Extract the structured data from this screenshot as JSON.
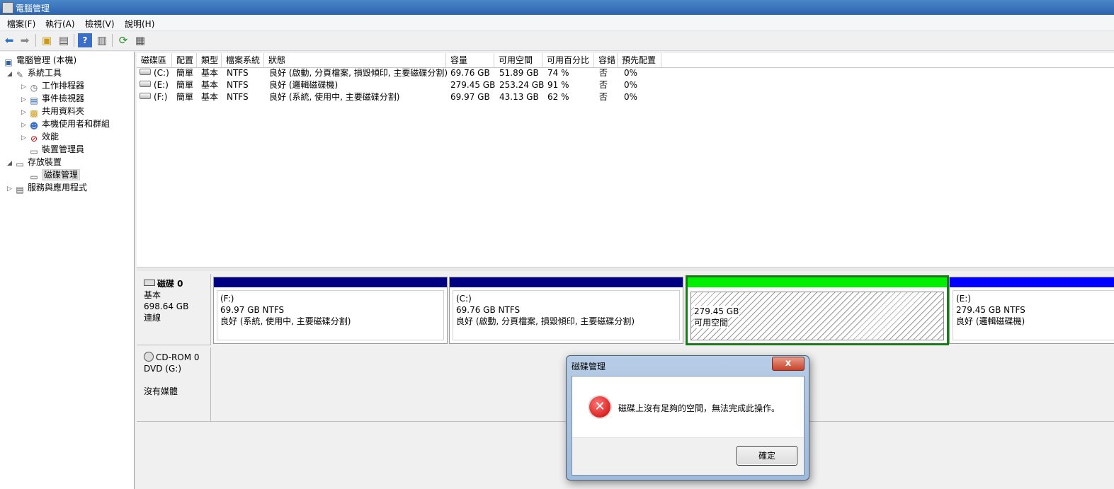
{
  "window": {
    "title": "電腦管理"
  },
  "menu": [
    "檔案(F)",
    "執行(A)",
    "檢視(V)",
    "說明(H)"
  ],
  "toolbar": {
    "buttons": [
      "back-icon",
      "forward-icon",
      "up-folder-icon",
      "show-hide-tree-icon",
      "help-icon",
      "show-action-pane-icon",
      "refresh-icon",
      "export-list-icon"
    ]
  },
  "tree": {
    "root": "電腦管理 (本機)",
    "system_tools": "系統工具",
    "task_scheduler": "工作排程器",
    "event_viewer": "事件檢視器",
    "shared_folders": "共用資料夾",
    "local_users": "本機使用者和群組",
    "performance": "效能",
    "device_manager": "裝置管理員",
    "storage": "存放裝置",
    "disk_management": "磁碟管理",
    "services_apps": "服務與應用程式"
  },
  "volume_table": {
    "headers": [
      "磁碟區",
      "配置",
      "類型",
      "檔案系統",
      "狀態",
      "容量",
      "可用空間",
      "可用百分比",
      "容錯",
      "預先配置"
    ],
    "rows": [
      [
        "(C:)",
        "簡單",
        "基本",
        "NTFS",
        "良好 (啟動, 分頁檔案, 損毀傾印, 主要磁碟分割)",
        "69.76 GB",
        "51.89 GB",
        "74 %",
        "否",
        "0%"
      ],
      [
        "(E:)",
        "簡單",
        "基本",
        "NTFS",
        "良好 (邏輯磁碟機)",
        "279.45 GB",
        "253.24 GB",
        "91 %",
        "否",
        "0%"
      ],
      [
        "(F:)",
        "簡單",
        "基本",
        "NTFS",
        "良好 (系統, 使用中, 主要磁碟分割)",
        "69.97 GB",
        "43.13 GB",
        "62 %",
        "否",
        "0%"
      ]
    ]
  },
  "disk0": {
    "name": "磁碟 0",
    "type": "基本",
    "size": "698.64 GB",
    "status": "連線",
    "partitions": [
      {
        "label": "(F:)",
        "size": "69.97 GB NTFS",
        "status": "良好 (系統, 使用中, 主要磁碟分割)",
        "color": "#000080"
      },
      {
        "label": "(C:)",
        "size": "69.76 GB NTFS",
        "status": "良好 (啟動, 分頁檔案, 損毀傾印, 主要磁碟分割)",
        "color": "#000080"
      },
      {
        "label": "",
        "size": "279.45 GB",
        "status": "可用空間",
        "color": "#00ee00"
      },
      {
        "label": "(E:)",
        "size": "279.45 GB NTFS",
        "status": "良好 (邏輯磁碟機)",
        "color": "#0000ff"
      }
    ]
  },
  "cdrom0": {
    "name": "CD-ROM 0",
    "type": "DVD (G:)",
    "status": "沒有媒體"
  },
  "dialog": {
    "title": "磁碟管理",
    "close": "x",
    "message": "磁碟上沒有足夠的空間，無法完成此操作。",
    "icon_glyph": "✕",
    "ok": "確定"
  }
}
